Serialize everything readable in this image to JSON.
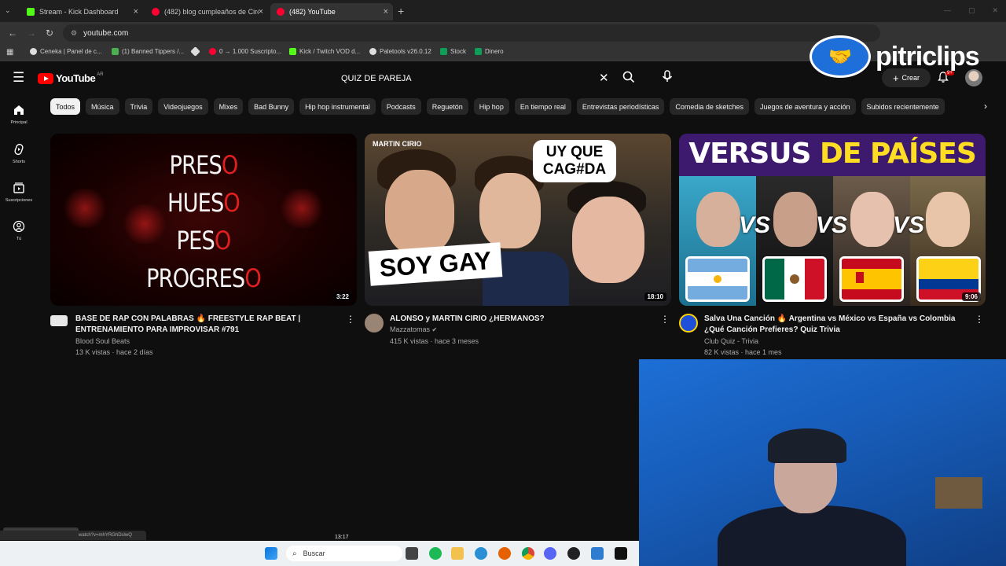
{
  "browser": {
    "tabs": [
      {
        "title": "Stream - Kick Dashboard",
        "color": "#53fc18"
      },
      {
        "title": "(482) blog cumpleaños de Ciro",
        "color": "#ff0033"
      },
      {
        "title": "(482) YouTube",
        "color": "#ff0033"
      }
    ],
    "url": "youtube.com",
    "bookmarks": [
      {
        "label": "Ceneka | Panel de c...",
        "color": "#dddddd"
      },
      {
        "label": "(1) Banned Tippers /...",
        "color": "#4caf50"
      },
      {
        "label": "",
        "color": "#dddddd"
      },
      {
        "label": "0 → 1.000 Suscripto...",
        "color": "#ff0033"
      },
      {
        "label": "Kick / Twitch VOD d...",
        "color": "#53fc18"
      },
      {
        "label": "Paletools v26.0.12",
        "color": "#dddddd"
      },
      {
        "label": "Stock",
        "color": "#0f9d58"
      },
      {
        "label": "Dinero",
        "color": "#0f9d58"
      }
    ]
  },
  "watermark": {
    "text": "pitriclips"
  },
  "youtube": {
    "logo": "YouTube",
    "country": "AR",
    "search_query": "QUIZ DE PAREJA",
    "create_label": "Crear",
    "notif_badge": "9+",
    "sidebar": [
      {
        "label": "Principal",
        "icon": "home-icon"
      },
      {
        "label": "Shorts",
        "icon": "shorts-icon"
      },
      {
        "label": "Suscripciones",
        "icon": "subscriptions-icon"
      },
      {
        "label": "Tú",
        "icon": "you-icon"
      }
    ],
    "chips": [
      "Todos",
      "Música",
      "Trivia",
      "Videojuegos",
      "Mixes",
      "Bad Bunny",
      "Hip hop instrumental",
      "Podcasts",
      "Reguetón",
      "Hip hop",
      "En tiempo real",
      "Entrevistas periodísticas",
      "Comedia de sketches",
      "Juegos de aventura y acción",
      "Subidos recientemente"
    ],
    "videos": [
      {
        "title": "BASE DE RAP CON PALABRAS 🔥 FREESTYLE RAP BEAT | ENTRENAMIENTO PARA IMPROVISAR #791",
        "channel": "Blood Soul Beats",
        "stats": "13 K vistas · hace 2 días",
        "duration": "3:22",
        "thumb_lines": [
          [
            "PRES",
            "O"
          ],
          [
            "HUES",
            "O"
          ],
          [
            "PES",
            "O"
          ],
          [
            "PROGRES",
            "O"
          ]
        ]
      },
      {
        "title": "ALONSO y MARTIN CIRIO ¿HERMANOS?",
        "channel": "Mazzatomas",
        "stats": "415 K vistas · hace 3 meses",
        "duration": "18:10",
        "thumb_name": "MARTIN CIRIO",
        "thumb_bubble": "UY QUE CAG#DA",
        "thumb_caption": "SOY GAY"
      },
      {
        "title": "Salva Una Canción 🔥 Argentina vs México vs España vs Colombia ¿Qué Canción Prefieres? Quiz Trivia",
        "channel": "Club Quiz - Trivia",
        "stats": "82 K vistas · hace 1 mes",
        "duration": "9:06",
        "thumb_head_a": "VERSUS ",
        "thumb_head_b": "DE PAÍSES",
        "thumb_vs": "VS"
      }
    ]
  },
  "taskbar": {
    "search_label": "Buscar",
    "time": "13:17",
    "status_url": "watch?v=mhYRGhDslwQ"
  }
}
